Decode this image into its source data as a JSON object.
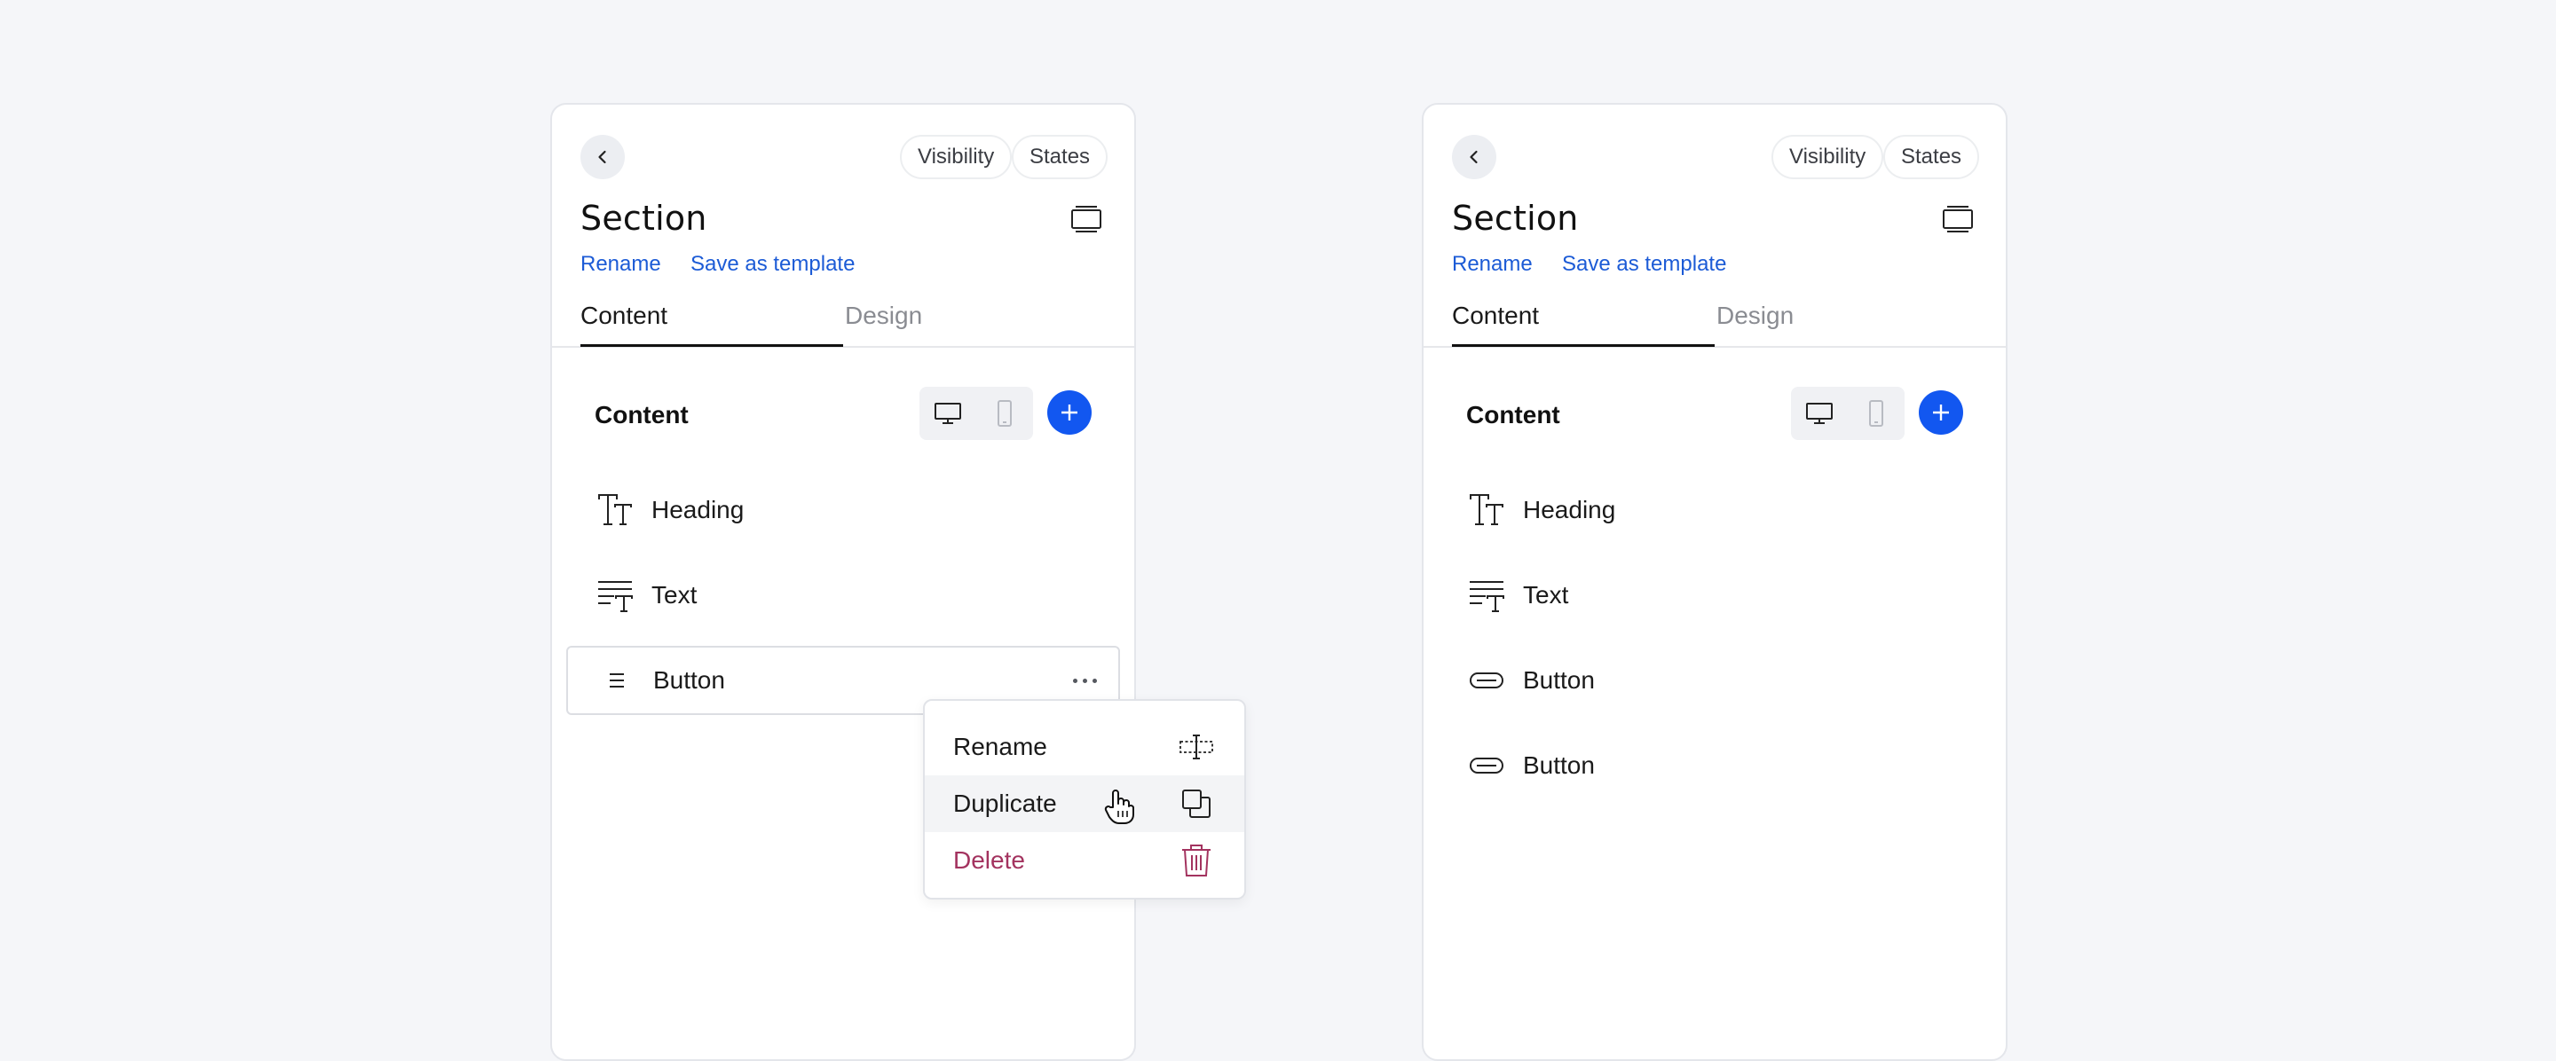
{
  "panels": [
    {
      "header": {
        "visibility_label": "Visibility",
        "states_label": "States",
        "title": "Section"
      },
      "links": {
        "rename": "Rename",
        "save_as_template": "Save as template"
      },
      "tabs": {
        "content": "Content",
        "design": "Design"
      },
      "content_section": {
        "label": "Content"
      },
      "items": [
        {
          "label": "Heading",
          "icon": "heading-icon"
        },
        {
          "label": "Text",
          "icon": "text-icon"
        },
        {
          "label": "Button",
          "icon": "drag-handle-icon",
          "selected": true
        }
      ],
      "context_menu": {
        "items": [
          {
            "label": "Rename",
            "icon": "rename-icon"
          },
          {
            "label": "Duplicate",
            "icon": "duplicate-icon",
            "hovered": true
          },
          {
            "label": "Delete",
            "icon": "trash-icon",
            "color": "#a3335f"
          }
        ]
      }
    },
    {
      "header": {
        "visibility_label": "Visibility",
        "states_label": "States",
        "title": "Section"
      },
      "links": {
        "rename": "Rename",
        "save_as_template": "Save as template"
      },
      "tabs": {
        "content": "Content",
        "design": "Design"
      },
      "content_section": {
        "label": "Content"
      },
      "items": [
        {
          "label": "Heading",
          "icon": "heading-icon"
        },
        {
          "label": "Text",
          "icon": "text-icon"
        },
        {
          "label": "Button",
          "icon": "button-icon"
        },
        {
          "label": "Button",
          "icon": "button-icon"
        }
      ]
    }
  ],
  "colors": {
    "accent": "#1257f0",
    "link": "#1c5bd6",
    "danger": "#a3335f",
    "background": "#f5f6f9"
  }
}
